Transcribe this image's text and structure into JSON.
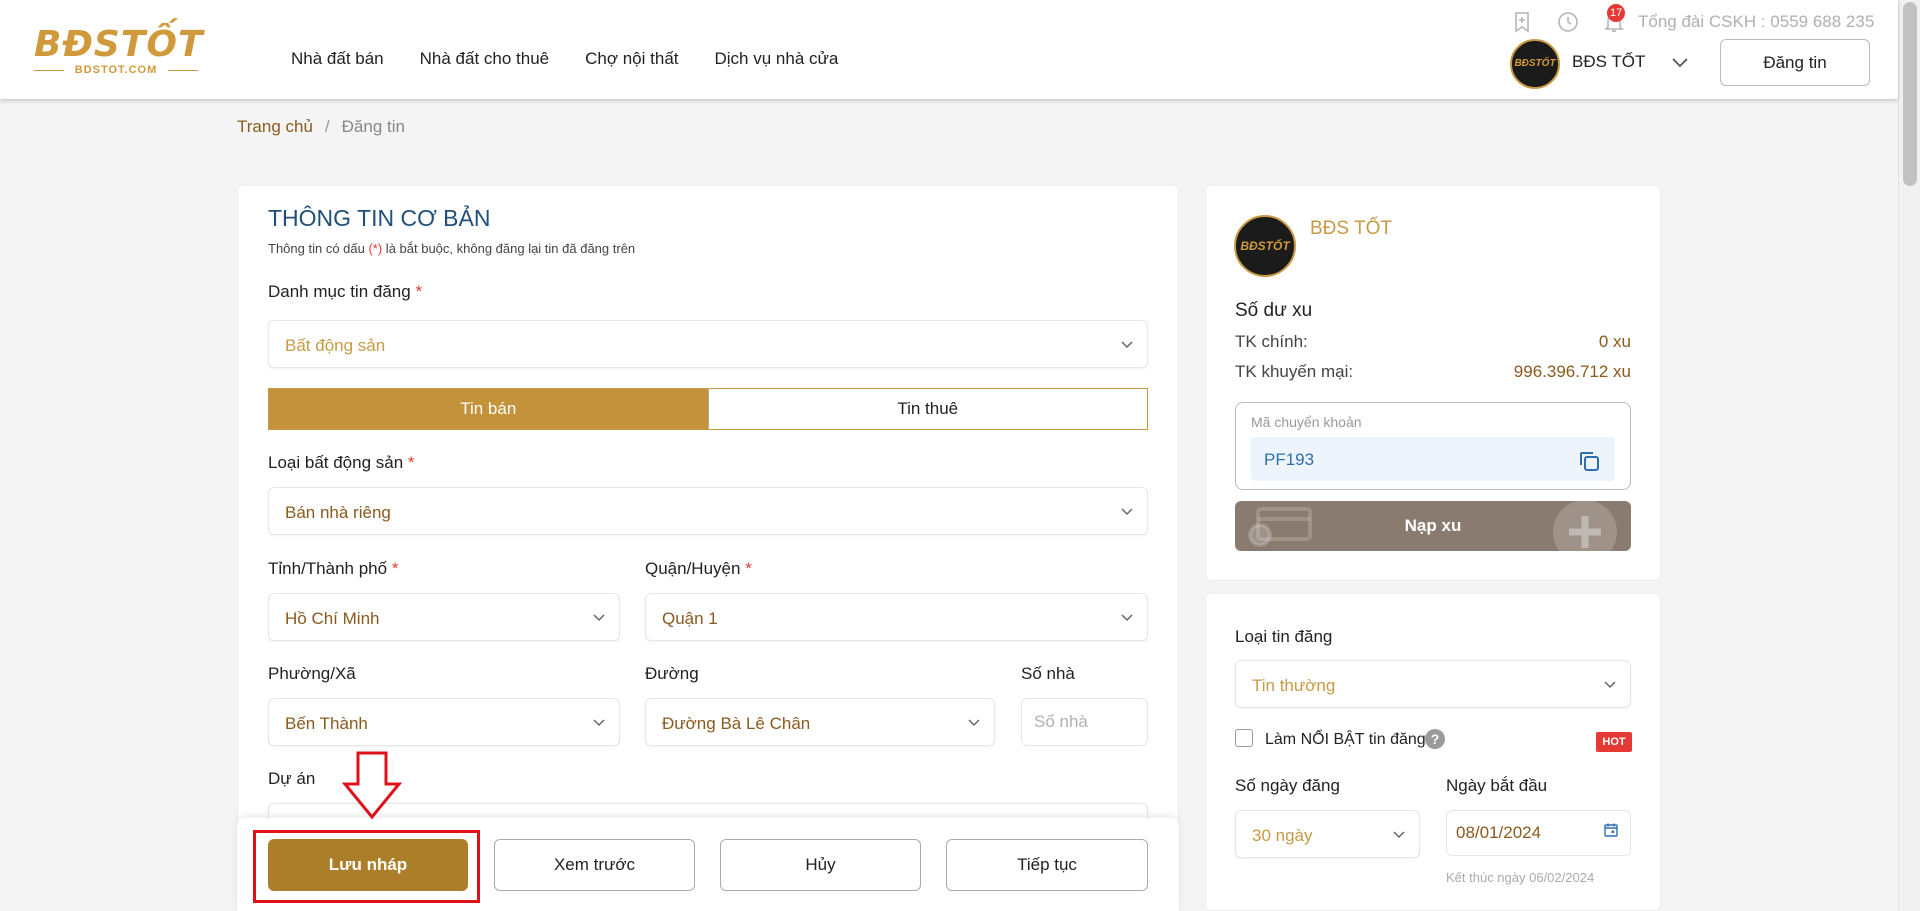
{
  "header": {
    "logo_main": "BĐSTỐT",
    "logo_sub": "BDSTOT.COM",
    "nav": [
      "Nhà đất bán",
      "Nhà đất cho thuê",
      "Chợ nội thất",
      "Dịch vụ nhà cửa"
    ],
    "notification_count": "17",
    "hotline": "Tổng đài CSKH : 0559 688 235",
    "user_name": "BĐS TỐT",
    "avatar_text": "BĐSTỐT",
    "post_button": "Đăng tin"
  },
  "breadcrumb": {
    "home": "Trang chủ",
    "sep": "/",
    "current": "Đăng tin"
  },
  "form": {
    "title": "THÔNG TIN CƠ BẢN",
    "note_pre": "Thông tin có dấu ",
    "note_req": "(*)",
    "note_post": " là bắt buộc, không đăng lại tin đã đăng trên",
    "req_mark": "*",
    "category_label": "Danh mục tin đăng",
    "category_value": "Bất động sản",
    "tabs": [
      "Tin bán",
      "Tin thuê"
    ],
    "property_type_label": "Loại bất động sản",
    "property_type_value": "Bán nhà riêng",
    "city_label": "Tỉnh/Thành phố",
    "city_value": "Hồ Chí Minh",
    "district_label": "Quận/Huyện",
    "district_value": "Quận 1",
    "ward_label": "Phường/Xã",
    "ward_value": "Bến Thành",
    "street_label": "Đường",
    "street_value": "Đường Bà Lê Chân",
    "house_no_label": "Số nhà",
    "house_no_placeholder": "Số nhà",
    "house_no_value": "",
    "project_label": "Dự án"
  },
  "actions": {
    "save_draft": "Lưu nháp",
    "preview": "Xem trước",
    "cancel": "Hủy",
    "continue": "Tiếp tục"
  },
  "account": {
    "name": "BĐS TỐT",
    "balance_title": "Số dư xu",
    "main_label": "TK chính:",
    "main_value": "0 xu",
    "promo_label": "TK khuyến mại:",
    "promo_value": "996.396.712 xu",
    "transfer_label": "Mã chuyển khoản",
    "transfer_code": "PF193",
    "topup_button": "Nạp xu"
  },
  "listing": {
    "type_label": "Loại tin đăng",
    "type_value": "Tin thường",
    "highlight_label": "Làm NỔI BẬT tin đăng",
    "help": "?",
    "hot": "HOT",
    "days_label": "Số ngày đăng",
    "days_value": "30 ngày",
    "start_label": "Ngày bắt đầu",
    "start_value": "08/01/2024",
    "end_note": "Kết thúc ngày 06/02/2024"
  },
  "colors": {
    "brand_gold": "#c4923a",
    "primary_button": "#ad7e2a",
    "highlight_red": "#e0101a",
    "title_blue": "#1f4f7a"
  }
}
